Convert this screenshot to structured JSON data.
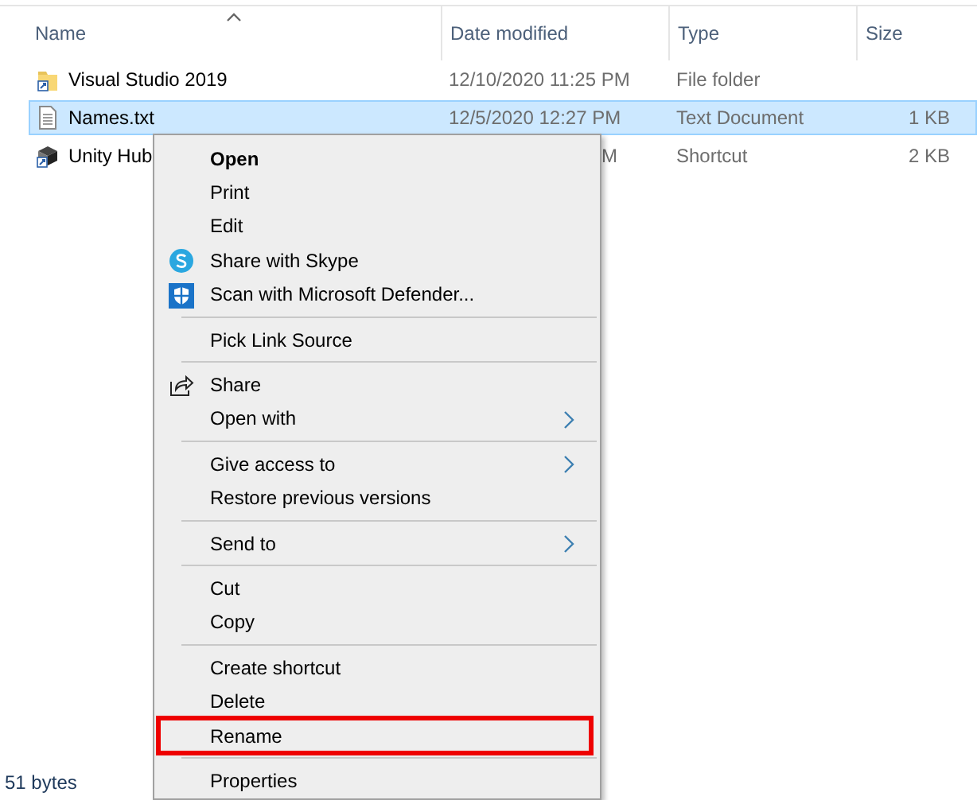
{
  "columns": [
    {
      "label": "Name",
      "sorted": true
    },
    {
      "label": "Date modified",
      "sorted": false
    },
    {
      "label": "Type",
      "sorted": false
    },
    {
      "label": "Size",
      "sorted": false
    }
  ],
  "files": [
    {
      "name": "Visual Studio 2019",
      "kind": "folder",
      "date": "12/10/2020 11:25 PM",
      "type": "File folder",
      "selected": false
    },
    {
      "name": "Names.txt",
      "kind": "text",
      "date": "12/5/2020 12:27 PM",
      "type": "Text Document",
      "size": "1 KB",
      "selected": true
    },
    {
      "name": "Unity Hub",
      "kind": "shortcut",
      "date": "M",
      "date_partial": true,
      "type": "Shortcut",
      "size": "2 KB",
      "selected": false
    }
  ],
  "context_menu": {
    "sections": [
      {
        "items": [
          {
            "label": "Open",
            "bold": true
          },
          {
            "label": "Print"
          },
          {
            "label": "Edit"
          },
          {
            "label": "Share with Skype",
            "kind": "skype"
          },
          {
            "label": "Scan with Microsoft Defender...",
            "kind": "defender"
          }
        ]
      },
      {
        "items": [
          {
            "label": "Pick Link Source"
          }
        ]
      },
      {
        "items": [
          {
            "label": "Share",
            "kind": "share"
          },
          {
            "label": "Open with",
            "submenu": true
          }
        ]
      },
      {
        "items": [
          {
            "label": "Give access to",
            "submenu": true
          },
          {
            "label": "Restore previous versions"
          }
        ]
      },
      {
        "items": [
          {
            "label": "Send to",
            "submenu": true
          }
        ]
      },
      {
        "items": [
          {
            "label": "Cut"
          },
          {
            "label": "Copy"
          }
        ]
      },
      {
        "items": [
          {
            "label": "Create shortcut"
          },
          {
            "label": "Delete"
          },
          {
            "label": "Rename",
            "highlighted": true
          }
        ]
      },
      {
        "items": [
          {
            "label": "Properties"
          }
        ]
      }
    ]
  },
  "status_bar": {
    "text": "51 bytes"
  }
}
